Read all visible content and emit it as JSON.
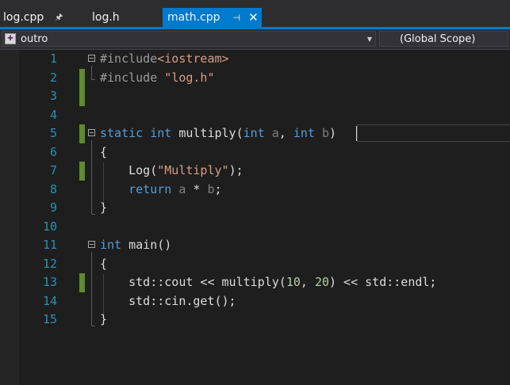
{
  "tabs": [
    {
      "label": "log.cpp",
      "pin": "🖈",
      "active": false
    },
    {
      "label": "log.h",
      "active": false
    },
    {
      "label": "math.cpp",
      "pin": "⊣",
      "close": "✕",
      "active": true
    }
  ],
  "navbar": {
    "project": "outro",
    "scope": "(Global Scope)"
  },
  "colors": {
    "accent": "#007acc",
    "editor_bg": "#1e1e1e",
    "line_number": "#2b91af",
    "keyword": "#569cd6",
    "string": "#d69d85",
    "number": "#b5cea8",
    "change_bar": "#5e8b2c"
  },
  "editor": {
    "line_numbers": [
      "1",
      "2",
      "3",
      "4",
      "5",
      "6",
      "7",
      "8",
      "9",
      "10",
      "11",
      "12",
      "13",
      "14",
      "15"
    ],
    "code": {
      "l1_directive": "#include",
      "l1_header": "<iostream>",
      "l2_directive": "#include ",
      "l2_header": "\"log.h\"",
      "l5_static": "static",
      "l5_int": "int",
      "l5_name": " multiply(",
      "l5_int2": "int",
      "l5_a": " a",
      "l5_comma": ", ",
      "l5_int3": "int",
      "l5_b": " b",
      "l5_close": ")",
      "l6": "{",
      "l7_call": "    Log(",
      "l7_str": "\"Multiply\"",
      "l7_end": ");",
      "l8_return": "    return",
      "l8_a": " a",
      "l8_op": " * ",
      "l8_b": "b",
      "l8_end": ";",
      "l9": "}",
      "l11_int": "int",
      "l11_rest": " main()",
      "l12": "{",
      "l13_a": "    std::cout << multiply(",
      "l13_n1": "10",
      "l13_comma": ", ",
      "l13_n2": "20",
      "l13_b": ") << std::endl;",
      "l14": "    std::cin.get();",
      "l15": "}"
    }
  }
}
